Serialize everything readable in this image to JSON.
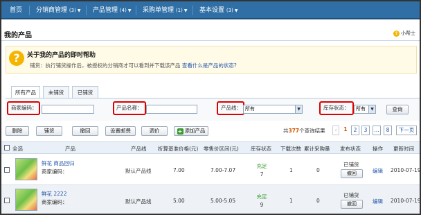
{
  "nav": {
    "items": [
      {
        "label": "首页",
        "count": "",
        "caret": ""
      },
      {
        "label": "分销商管理",
        "count": "(3)",
        "caret": "▼"
      },
      {
        "label": "产品管理",
        "count": "(4)",
        "caret": "▼"
      },
      {
        "label": "采购单管理",
        "count": "(1)",
        "caret": "▼"
      },
      {
        "label": "基本设置",
        "count": "(3)",
        "caret": "▼"
      }
    ]
  },
  "page": {
    "title": "我的产品",
    "helper_icon": "?",
    "helper_label": "小帮士"
  },
  "help": {
    "icon": "?",
    "title": "关于我的产品的即时帮助",
    "desc": "铺货：执行铺货操作后，被授权的分销商才可以看到并下载该产品",
    "link": "查看什么是产品的状态?"
  },
  "tabs": [
    "所有产品",
    "未铺货",
    "已铺货"
  ],
  "filter": {
    "merchant_code_label": "商家编码：",
    "product_name_label": "产品名称：",
    "product_line_label": "产品线：",
    "product_line_value": "所有",
    "stock_status_label": "库存状态：",
    "stock_status_value": "所有",
    "query_button": "查询",
    "select_arrow": "▼"
  },
  "actions": {
    "delete": "删除",
    "distribute": "铺货",
    "withdraw": "撤回",
    "set_postage": "设置邮费",
    "adjust_price": "调价",
    "add_product_plus": "+",
    "add_product": "添加产品"
  },
  "pagination": {
    "total_prefix": "共",
    "total_count": "377",
    "total_suffix": "个查询结果",
    "prev": "‹",
    "pages": [
      "1",
      "2",
      "3",
      "...",
      "8"
    ],
    "next": "下一页"
  },
  "table": {
    "headers": [
      "全选",
      "产品",
      "产品线",
      "折算基准价格(元)",
      "零售价区间(元)",
      "库存状态",
      "下载次数",
      "累计采购量",
      "发布状态",
      "操作",
      "更新时间"
    ],
    "rows": [
      {
        "name": "鲜花 商品回归",
        "merchant_code": "商家编码：",
        "line": "默认产品线",
        "base_price": "7.00",
        "price_range": "7.00-7.07",
        "stock_status": "充足",
        "stock_num": "7",
        "downloads": "1",
        "purchases": "0",
        "publish_status": "已铺货",
        "withdraw_btn": "撤回",
        "op": "编辑",
        "updated": "2010-07-19"
      },
      {
        "name": "鲜花 2222",
        "merchant_code": "商家编码：",
        "line": "默认产品线",
        "base_price": "5.00",
        "price_range": "5.00-5.05",
        "stock_status": "充足",
        "stock_num": "9",
        "downloads": "1",
        "purchases": "0",
        "publish_status": "已铺货",
        "withdraw_btn": "撤回",
        "op": "编辑",
        "updated": "2010-07-19"
      }
    ]
  }
}
